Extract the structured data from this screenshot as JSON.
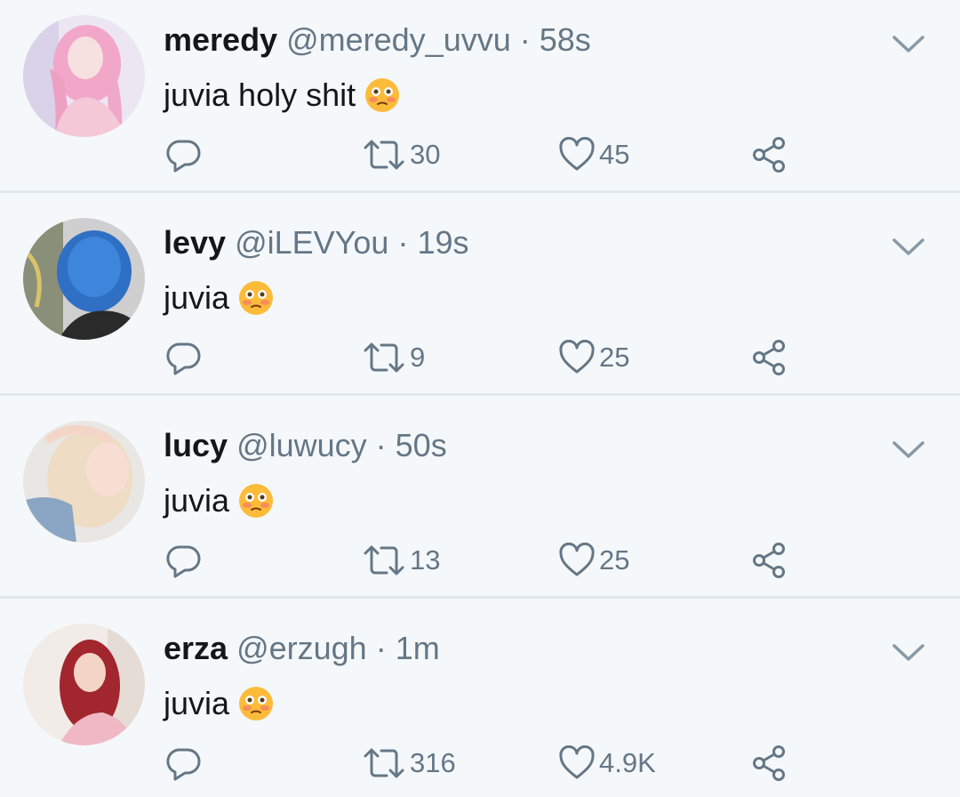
{
  "tweets": [
    {
      "name": "meredy",
      "handle": "@meredy_uvvu",
      "time": "· 58s",
      "text": "juvia holy shit",
      "emoji_icon": "flushed-face-emoji",
      "retweets": "30",
      "likes": "45"
    },
    {
      "name": "levy",
      "handle": "@iLEVYou",
      "time": "· 19s",
      "text": "juvia",
      "emoji_icon": "flushed-face-emoji",
      "retweets": "9",
      "likes": "25"
    },
    {
      "name": "lucy",
      "handle": "@luwucy",
      "time": "· 50s",
      "text": "juvia",
      "emoji_icon": "flushed-face-emoji",
      "retweets": "13",
      "likes": "25"
    },
    {
      "name": "erza",
      "handle": "@erzugh",
      "time": "· 1m",
      "text": "juvia",
      "emoji_icon": "flushed-face-emoji",
      "retweets": "316",
      "likes": "4.9K"
    }
  ],
  "icons": {
    "reply": "reply-icon",
    "retweet": "retweet-icon",
    "like": "heart-icon",
    "share": "share-icon",
    "menu": "chevron-down-icon"
  },
  "colors": {
    "background": "#f5f8fa",
    "text": "#14171a",
    "secondary": "#657786",
    "divider": "#e1e8ed"
  }
}
